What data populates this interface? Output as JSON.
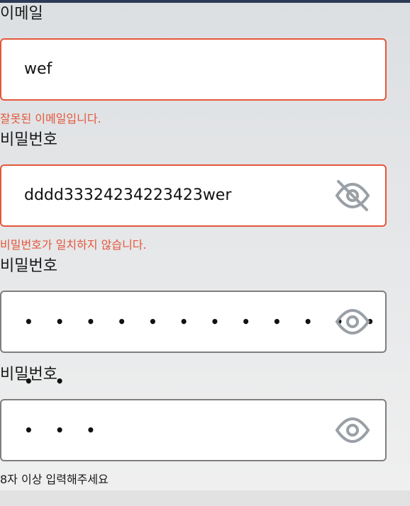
{
  "email": {
    "label": "이메일",
    "value": "wef",
    "error": "잘못된 이메일입니다."
  },
  "password": {
    "label": "비밀번호",
    "value": "dddd33324234223423wer",
    "visibility_icon": "eye-off-icon",
    "error": "비밀번호가 일치하지 않습니다."
  },
  "password_confirm": {
    "label": "비밀번호",
    "value": "• • • • • • • • • • • • • •",
    "visibility_icon": "eye-icon"
  },
  "password_extra": {
    "label": "비밀번호",
    "value": "• • •",
    "visibility_icon": "eye-icon",
    "hint": "8자 이상 입력해주세요"
  },
  "colors": {
    "error": "#e4573b",
    "icon": "#9aa0a6"
  }
}
